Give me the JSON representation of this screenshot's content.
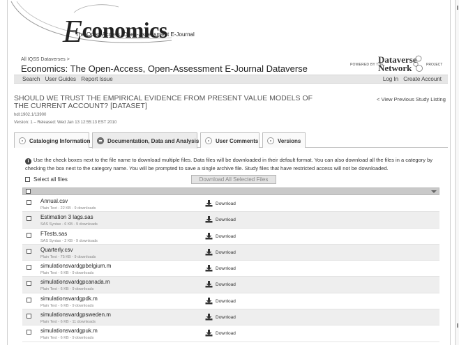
{
  "header": {
    "logo_rest": "conomics",
    "logo_letter": "E",
    "logo_subtitle": "The Open-Access, Open-Assessment E-Journal",
    "breadcrumb": "All IQSS Dataverses >",
    "dataverse_title": "Economics: The Open-Access, Open-Assessment E-Journal Dataverse",
    "powered_by": "POWERED BY THE",
    "dvn_line1": "Dataverse",
    "dvn_line2": "Network",
    "project": "PROJECT"
  },
  "nav": {
    "left": [
      "Search",
      "User Guides",
      "Report Issue"
    ],
    "right": [
      "Log In",
      "Create Account"
    ]
  },
  "study": {
    "title": "SHOULD WE TRUST THE EMPIRICAL EVIDENCE FROM PRESENT VALUE MODELS OF THE CURRENT ACCOUNT? [DATASET]",
    "view_previous": "< View Previous Study Listing",
    "handle": "hdl:1902.1/13900",
    "version": "Version: 1 – Released: Wed Jan 13 12:55:13 EST 2010"
  },
  "tabs": [
    {
      "label": "Cataloging Information",
      "active": false
    },
    {
      "label": "Documentation, Data and Analysis",
      "active": true
    },
    {
      "label": "User Comments",
      "active": false
    },
    {
      "label": "Versions",
      "active": false
    }
  ],
  "info_text": "Use the check boxes next to the file name to download multiple files. Data files will be downloaded in their default format. You can also download all the files in a category by checking the box next to the category name. You will be prompted to save a single archive file. Study files that have restricted access will not be downloaded.",
  "select_all_label": "Select all files",
  "download_all_label": "Download All Selected Files",
  "download_label": "Download",
  "files": [
    {
      "name": "Annual.csv",
      "meta": "Plain Text - 22 KB - 9 downloads"
    },
    {
      "name": "Estimation 3 lags.sas",
      "meta": "SAS Syntax - 6 KB - 9 downloads"
    },
    {
      "name": "FTests.sas",
      "meta": "SAS Syntax - 2 KB - 9 downloads"
    },
    {
      "name": "Quarterly.csv",
      "meta": "Plain Text - 75 KB - 9 downloads"
    },
    {
      "name": "simulationsvardgpbelgium.m",
      "meta": "Plain Text - 6 KB - 9 downloads"
    },
    {
      "name": "simulationsvardgpcanada.m",
      "meta": "Plain Text - 6 KB - 9 downloads"
    },
    {
      "name": "simulationsvardgpdk.m",
      "meta": "Plain Text - 6 KB - 9 downloads"
    },
    {
      "name": "simulationsvardgpsweden.m",
      "meta": "Plain Text - 6 KB - 11 downloads"
    },
    {
      "name": "simulationsvardgpuk.m",
      "meta": "Plain Text - 6 KB - 9 downloads"
    }
  ]
}
